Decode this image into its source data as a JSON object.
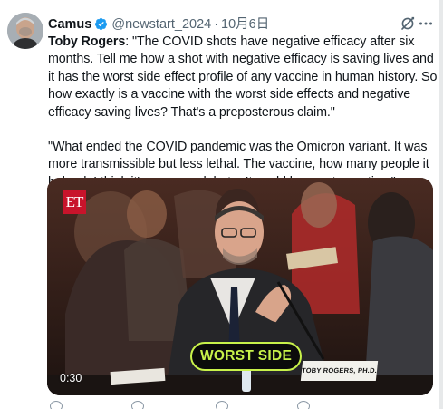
{
  "author": {
    "name": "Camus",
    "handle": "@newstart_2024",
    "separator": "·",
    "date": "10月6日"
  },
  "tweet": {
    "speaker": "Toby Rogers",
    "quote1_rest": ": \"The COVID shots have negative efficacy after six months. Tell me how a shot with negative efficacy is saving lives and it has the worst side effect profile of any vaccine in human history. So how exactly is a vaccine with the worst side effects and negative efficacy saving lives? That's a preposterous claim.\"",
    "quote2": "\"What ended the COVID pandemic was the Omicron variant. It was more transmissible but less lethal. The vaccine, how many people it helped, I think it's an open debate. It could be a net negative.\""
  },
  "video": {
    "logo": "ET",
    "caption": "WORST SIDE",
    "duration": "0:30",
    "nameplate": "TOBY ROGERS, PH.D."
  },
  "icons": {
    "verified": "verified-badge-icon",
    "grok": "grok-icon",
    "more": "more-icon"
  },
  "colors": {
    "verified": "#1d9bf0",
    "caption_text": "#c8f24a",
    "et_red": "#c8142b",
    "secondary_text": "#536471"
  }
}
